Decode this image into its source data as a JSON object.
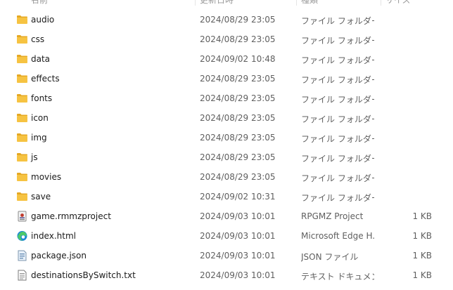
{
  "header": {
    "name": "名前",
    "date": "更新日時",
    "type": "種類",
    "size": "サイズ"
  },
  "files": [
    {
      "name": "audio",
      "date": "2024/08/29 23:05",
      "type": "ファイル フォルダー",
      "size": "",
      "icon": "folder-icon"
    },
    {
      "name": "css",
      "date": "2024/08/29 23:05",
      "type": "ファイル フォルダー",
      "size": "",
      "icon": "folder-icon"
    },
    {
      "name": "data",
      "date": "2024/09/02 10:48",
      "type": "ファイル フォルダー",
      "size": "",
      "icon": "folder-icon"
    },
    {
      "name": "effects",
      "date": "2024/08/29 23:05",
      "type": "ファイル フォルダー",
      "size": "",
      "icon": "folder-icon"
    },
    {
      "name": "fonts",
      "date": "2024/08/29 23:05",
      "type": "ファイル フォルダー",
      "size": "",
      "icon": "folder-icon"
    },
    {
      "name": "icon",
      "date": "2024/08/29 23:05",
      "type": "ファイル フォルダー",
      "size": "",
      "icon": "folder-icon"
    },
    {
      "name": "img",
      "date": "2024/08/29 23:05",
      "type": "ファイル フォルダー",
      "size": "",
      "icon": "folder-icon"
    },
    {
      "name": "js",
      "date": "2024/08/29 23:05",
      "type": "ファイル フォルダー",
      "size": "",
      "icon": "folder-icon"
    },
    {
      "name": "movies",
      "date": "2024/08/29 23:05",
      "type": "ファイル フォルダー",
      "size": "",
      "icon": "folder-icon"
    },
    {
      "name": "save",
      "date": "2024/09/02 10:31",
      "type": "ファイル フォルダー",
      "size": "",
      "icon": "folder-icon"
    },
    {
      "name": "game.rmmzproject",
      "date": "2024/09/03 10:01",
      "type": "RPGMZ Project",
      "size": "1 KB",
      "icon": "rpgmz-project-icon"
    },
    {
      "name": "index.html",
      "date": "2024/09/03 10:01",
      "type": "Microsoft Edge H...",
      "size": "1 KB",
      "icon": "edge-icon"
    },
    {
      "name": "package.json",
      "date": "2024/09/03 10:01",
      "type": "JSON ファイル",
      "size": "1 KB",
      "icon": "json-file-icon"
    },
    {
      "name": "destinationsBySwitch.txt",
      "date": "2024/09/03 10:01",
      "type": "テキスト ドキュメント",
      "size": "1 KB",
      "icon": "text-file-icon"
    }
  ],
  "colors": {
    "folder": "#f6c342",
    "folder_dark": "#e5a823",
    "edge_blue": "#1b87d6",
    "edge_green": "#4cc96b"
  }
}
